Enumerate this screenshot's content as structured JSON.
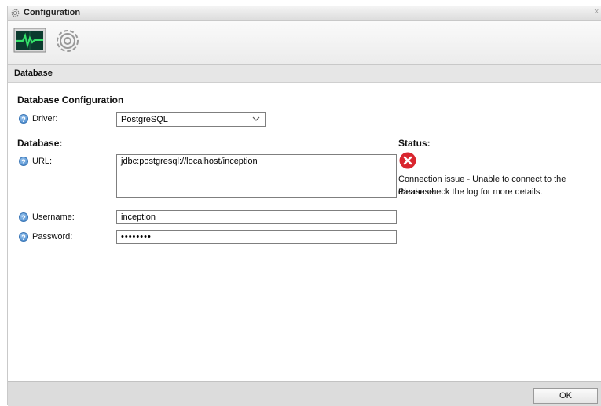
{
  "window": {
    "title": "Configuration",
    "close_glyph": "×"
  },
  "toolbar": {
    "items": [
      {
        "name": "monitor-icon",
        "selected": true
      },
      {
        "name": "gear-icon",
        "selected": false
      }
    ]
  },
  "section": {
    "title": "Database"
  },
  "form": {
    "heading": "Database Configuration",
    "driver": {
      "label": "Driver:",
      "value": "PostgreSQL"
    },
    "database_heading": "Database:",
    "url": {
      "label": "URL:",
      "value": "jdbc:postgresql://localhost/inception"
    },
    "username": {
      "label": "Username:",
      "value": "inception"
    },
    "password": {
      "label": "Password:",
      "value": "••••••••"
    }
  },
  "status": {
    "heading": "Status:",
    "icon": "error-icon",
    "line1": "Connection issue - Unable to connect to the database.",
    "line2": "Please check the log for more details."
  },
  "footer": {
    "ok_label": "OK"
  },
  "help_glyph": "?",
  "colors": {
    "error": "#d9262f",
    "help": "#3f82c8",
    "monitor_bg": "#0b3b2e",
    "monitor_line": "#35e46a"
  }
}
